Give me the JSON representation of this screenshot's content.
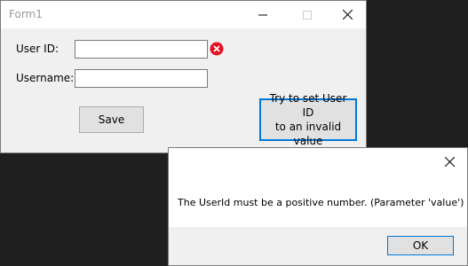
{
  "form": {
    "title": "Form1",
    "user_id_label": "User ID:",
    "username_label": "Username:",
    "user_id_value": "",
    "username_value": "",
    "save_label": "Save",
    "invalid_button_label": "Try to set User ID\nto an invalid value",
    "error_icon": "error-icon",
    "accent_color": "#0078d7",
    "error_color": "#e81123"
  },
  "dialog": {
    "message": "The UserId must be a positive number. (Parameter 'value')",
    "ok_label": "OK"
  }
}
